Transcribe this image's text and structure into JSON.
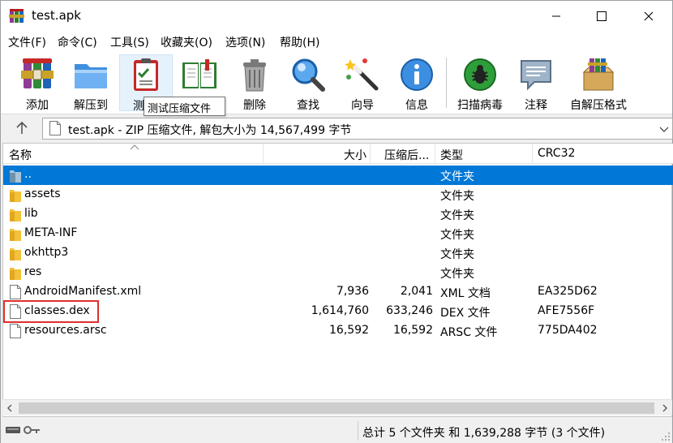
{
  "window": {
    "title": "test.apk"
  },
  "menu": [
    {
      "label": "文件(F)"
    },
    {
      "label": "命令(C)"
    },
    {
      "label": "工具(S)"
    },
    {
      "label": "收藏夹(O)"
    },
    {
      "label": "选项(N)"
    },
    {
      "label": "帮助(H)"
    }
  ],
  "toolbar": {
    "buttons": [
      {
        "label": "添加",
        "icon": "add-archive-icon"
      },
      {
        "label": "解压到",
        "icon": "extract-folder-icon"
      },
      {
        "label": "测",
        "icon": "test-clipboard-icon"
      },
      {
        "label": "",
        "icon": "view-book-icon"
      },
      {
        "label": "删除",
        "icon": "trash-can-icon"
      },
      {
        "label": "查找",
        "icon": "magnifier-icon"
      },
      {
        "label": "向导",
        "icon": "wizard-wand-icon"
      },
      {
        "label": "信息",
        "icon": "info-icon"
      },
      {
        "label": "扫描病毒",
        "icon": "virus-scan-icon"
      },
      {
        "label": "注释",
        "icon": "comment-icon"
      },
      {
        "label": "自解压格式",
        "icon": "sfx-box-icon"
      }
    ],
    "tooltip": "测试压缩文件"
  },
  "address": {
    "text": "test.apk - ZIP 压缩文件, 解包大小为 14,567,499 字节"
  },
  "columns": {
    "name": "名称",
    "size": "大小",
    "packed": "压缩后...",
    "type": "类型",
    "crc": "CRC32"
  },
  "files": [
    {
      "name": "..",
      "size": "",
      "packed": "",
      "type": "文件夹",
      "crc": "",
      "kind": "parent",
      "selected": true
    },
    {
      "name": "assets",
      "size": "",
      "packed": "",
      "type": "文件夹",
      "crc": "",
      "kind": "folder"
    },
    {
      "name": "lib",
      "size": "",
      "packed": "",
      "type": "文件夹",
      "crc": "",
      "kind": "folder"
    },
    {
      "name": "META-INF",
      "size": "",
      "packed": "",
      "type": "文件夹",
      "crc": "",
      "kind": "folder"
    },
    {
      "name": "okhttp3",
      "size": "",
      "packed": "",
      "type": "文件夹",
      "crc": "",
      "kind": "folder"
    },
    {
      "name": "res",
      "size": "",
      "packed": "",
      "type": "文件夹",
      "crc": "",
      "kind": "folder"
    },
    {
      "name": "AndroidManifest.xml",
      "size": "7,936",
      "packed": "2,041",
      "type": "XML 文档",
      "crc": "EA325D62",
      "kind": "file"
    },
    {
      "name": "classes.dex",
      "size": "1,614,760",
      "packed": "633,246",
      "type": "DEX 文件",
      "crc": "AFE7556F",
      "kind": "file"
    },
    {
      "name": "resources.arsc",
      "size": "16,592",
      "packed": "16,592",
      "type": "ARSC 文件",
      "crc": "775DA402",
      "kind": "file"
    }
  ],
  "status": {
    "text": "总计 5 个文件夹 和 1,639,288 字节 (3 个文件)"
  },
  "colors": {
    "selection": "#0078d7",
    "highlight": "#e03030",
    "folder": "#f3c13a"
  }
}
